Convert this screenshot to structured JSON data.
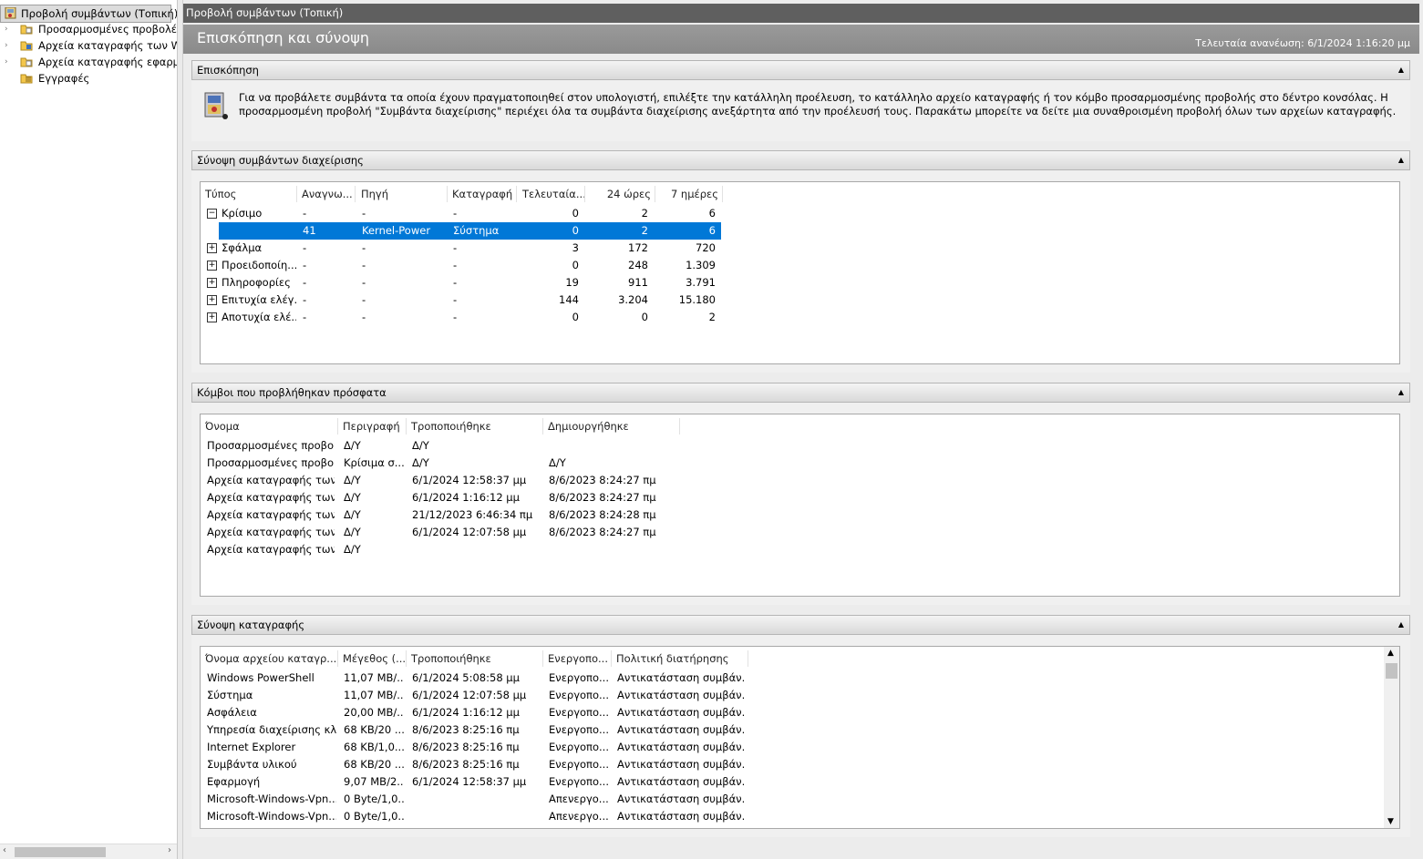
{
  "tree": {
    "items": [
      {
        "label": "Προβολή συμβάντων (Τοπική)",
        "icon": "event-viewer-icon",
        "arrow": ""
      },
      {
        "label": "Προσαρμοσμένες προβολές",
        "icon": "folder-icon",
        "arrow": "›"
      },
      {
        "label": "Αρχεία καταγραφής των Windows",
        "icon": "folder-icon",
        "arrow": "›"
      },
      {
        "label": "Αρχεία καταγραφής εφαρμογών",
        "icon": "folder-icon",
        "arrow": "›"
      },
      {
        "label": "Εγγραφές",
        "icon": "subscription-icon",
        "arrow": ""
      }
    ]
  },
  "title_bar": "Προβολή συμβάντων (Τοπική)",
  "header": {
    "title": "Επισκόπηση και σύνοψη",
    "last_update": "Τελευταία ανανέωση: 6/1/2024 1:16:20 μμ"
  },
  "overview": {
    "title": "Επισκόπηση",
    "text": "Για να προβάλετε συμβάντα τα οποία έχουν πραγματοποιηθεί στον υπολογιστή, επιλέξτε την κατάλληλη προέλευση, το κατάλληλο αρχείο καταγραφής ή τον κόμβο προσαρμοσμένης προβολής στο δέντρο κονσόλας. Η προσαρμοσμένη προβολή \"Συμβάντα διαχείρισης\" περιέχει όλα τα συμβάντα διαχείρισης ανεξάρτητα από την προέλευσή τους. Παρακάτω μπορείτε να δείτε μια συναθροισμένη προβολή όλων των αρχείων καταγραφής."
  },
  "summary": {
    "title": "Σύνοψη συμβάντων διαχείρισης",
    "columns": [
      "Τύπος",
      "Αναγνω...",
      "Πηγή",
      "Καταγραφή",
      "Τελευταία...",
      "24 ώρες",
      "7 ημέρες"
    ],
    "rows": [
      {
        "exp": "−",
        "type": "Κρίσιμο",
        "id": "-",
        "source": "-",
        "log": "-",
        "last": "0",
        "h24": "2",
        "d7": "6"
      },
      {
        "exp": "",
        "type": "",
        "id": "41",
        "source": "Kernel-Power",
        "log": "Σύστημα",
        "last": "0",
        "h24": "2",
        "d7": "6"
      },
      {
        "exp": "+",
        "type": "Σφάλμα",
        "id": "-",
        "source": "-",
        "log": "-",
        "last": "3",
        "h24": "172",
        "d7": "720"
      },
      {
        "exp": "+",
        "type": "Προειδοποίη...",
        "id": "-",
        "source": "-",
        "log": "-",
        "last": "0",
        "h24": "248",
        "d7": "1.309"
      },
      {
        "exp": "+",
        "type": "Πληροφορίες",
        "id": "-",
        "source": "-",
        "log": "-",
        "last": "19",
        "h24": "911",
        "d7": "3.791"
      },
      {
        "exp": "+",
        "type": "Επιτυχία ελέγ...",
        "id": "-",
        "source": "-",
        "log": "-",
        "last": "144",
        "h24": "3.204",
        "d7": "15.180"
      },
      {
        "exp": "+",
        "type": "Αποτυχία ελέ...",
        "id": "-",
        "source": "-",
        "log": "-",
        "last": "0",
        "h24": "0",
        "d7": "2"
      }
    ]
  },
  "recent": {
    "title": "Κόμβοι που προβλήθηκαν πρόσφατα",
    "columns": [
      "Όνομα",
      "Περιγραφή",
      "Τροποποιήθηκε",
      "Δημιουργήθηκε"
    ],
    "rows": [
      [
        "Προσαρμοσμένες προβο...",
        "Δ/Υ",
        "Δ/Υ",
        ""
      ],
      [
        "Προσαρμοσμένες προβο...",
        "Κρίσιμα σ...",
        "Δ/Υ",
        "Δ/Υ"
      ],
      [
        "Αρχεία καταγραφής των...",
        "Δ/Υ",
        "6/1/2024 12:58:37 μμ",
        "8/6/2023 8:24:27 πμ"
      ],
      [
        "Αρχεία καταγραφής των...",
        "Δ/Υ",
        "6/1/2024 1:16:12 μμ",
        "8/6/2023 8:24:27 πμ"
      ],
      [
        "Αρχεία καταγραφής των...",
        "Δ/Υ",
        "21/12/2023 6:46:34 πμ",
        "8/6/2023 8:24:28 πμ"
      ],
      [
        "Αρχεία καταγραφής των...",
        "Δ/Υ",
        "6/1/2024 12:07:58 μμ",
        "8/6/2023 8:24:27 πμ"
      ],
      [
        "Αρχεία καταγραφής των...",
        "Δ/Υ",
        "",
        ""
      ]
    ]
  },
  "logs": {
    "title": "Σύνοψη καταγραφής",
    "columns": [
      "Όνομα αρχείου καταγρ...",
      "Μέγεθος (...",
      "Τροποποιήθηκε",
      "Ενεργοπο...",
      "Πολιτική διατήρησης"
    ],
    "rows": [
      [
        "Windows PowerShell",
        "11,07 MB/...",
        "6/1/2024 5:08:58 μμ",
        "Ενεργοπο...",
        "Αντικατάσταση συμβάν..."
      ],
      [
        "Σύστημα",
        "11,07 MB/...",
        "6/1/2024 12:07:58 μμ",
        "Ενεργοπο...",
        "Αντικατάσταση συμβάν..."
      ],
      [
        "Ασφάλεια",
        "20,00 MB/...",
        "6/1/2024 1:16:12 μμ",
        "Ενεργοπο...",
        "Αντικατάσταση συμβάν..."
      ],
      [
        "Υπηρεσία διαχείρισης κλ...",
        "68 KB/20 ...",
        "8/6/2023 8:25:16 πμ",
        "Ενεργοπο...",
        "Αντικατάσταση συμβάν..."
      ],
      [
        "Internet Explorer",
        "68 KB/1,0...",
        "8/6/2023 8:25:16 πμ",
        "Ενεργοπο...",
        "Αντικατάσταση συμβάν..."
      ],
      [
        "Συμβάντα υλικού",
        "68 KB/20 ...",
        "8/6/2023 8:25:16 πμ",
        "Ενεργοπο...",
        "Αντικατάσταση συμβάν..."
      ],
      [
        "Εφαρμογή",
        "9,07 MB/2...",
        "6/1/2024 12:58:37 μμ",
        "Ενεργοπο...",
        "Αντικατάσταση συμβάν..."
      ],
      [
        "Microsoft-Windows-Vpn...",
        "0 Byte/1,0...",
        "",
        "Απενεργο...",
        "Αντικατάσταση συμβάν..."
      ],
      [
        "Microsoft-Windows-Vpn...",
        "0 Byte/1,0...",
        "",
        "Απενεργο...",
        "Αντικατάσταση συμβάν..."
      ]
    ]
  }
}
